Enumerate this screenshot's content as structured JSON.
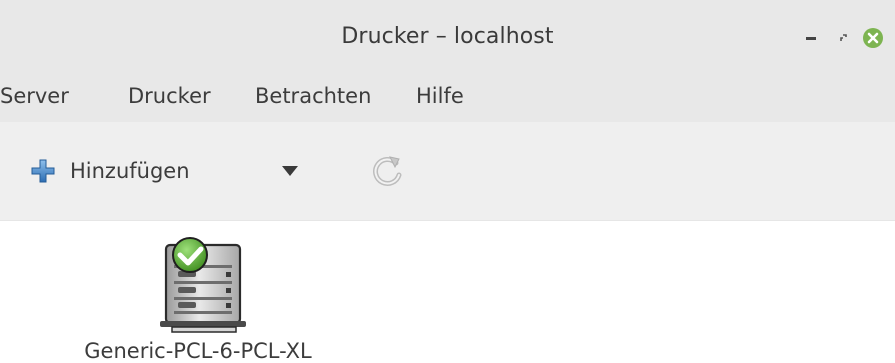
{
  "window": {
    "title": "Drucker – localhost",
    "controls": {
      "minimize_icon": "minimize-icon",
      "maximize_icon": "maximize-icon",
      "close_icon": "close-icon"
    },
    "close_color": "#7db451"
  },
  "menu": {
    "items": [
      {
        "label": "Server"
      },
      {
        "label": "Drucker"
      },
      {
        "label": "Betrachten"
      },
      {
        "label": "Hilfe"
      }
    ]
  },
  "toolbar": {
    "add_label": "Hinzufügen",
    "add_icon": "plus-icon",
    "dropdown_icon": "chevron-down-icon",
    "refresh_icon": "refresh-icon"
  },
  "printers": [
    {
      "name": "Generic-PCL-6-PCL-XL",
      "status": "default",
      "icon": "printer-icon"
    }
  ],
  "colors": {
    "header_bg": "#e8e8e8",
    "toolbar_bg": "#efefef",
    "accent_blue": "#3d7fc4",
    "status_green": "#4a9a2f"
  }
}
